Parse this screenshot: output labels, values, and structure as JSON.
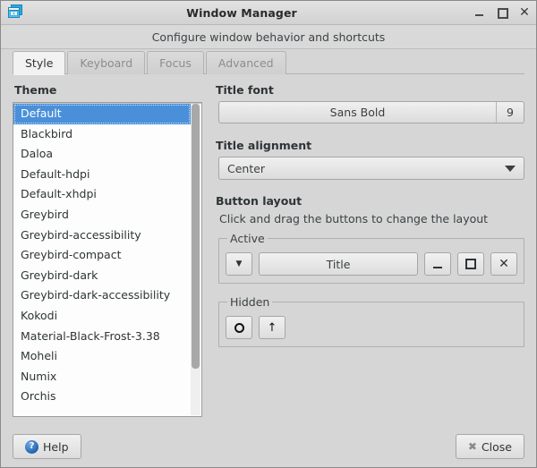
{
  "window": {
    "title": "Window Manager",
    "subtitle": "Configure window behavior and shortcuts",
    "icon": "window-stack-icon",
    "controls": {
      "minimize": "–",
      "maximize": "□",
      "close": "✕"
    }
  },
  "tabs": [
    {
      "label": "Style",
      "active": true
    },
    {
      "label": "Keyboard",
      "active": false
    },
    {
      "label": "Focus",
      "active": false
    },
    {
      "label": "Advanced",
      "active": false
    }
  ],
  "theme": {
    "label": "Theme",
    "selected": "Default",
    "items": [
      "Default",
      "Blackbird",
      "Daloa",
      "Default-hdpi",
      "Default-xhdpi",
      "Greybird",
      "Greybird-accessibility",
      "Greybird-compact",
      "Greybird-dark",
      "Greybird-dark-accessibility",
      "Kokodi",
      "Material-Black-Frost-3.38",
      "Moheli",
      "Numix",
      "Orchis"
    ],
    "scroll_thumb_percent": 85
  },
  "title_font": {
    "label": "Title font",
    "font_name": "Sans Bold",
    "font_size": "9"
  },
  "title_alignment": {
    "label": "Title alignment",
    "value": "Center"
  },
  "button_layout": {
    "label": "Button layout",
    "hint": "Click and drag the buttons to change the layout",
    "active": {
      "legend": "Active",
      "buttons": [
        {
          "name": "menu-button",
          "glyph": "▼"
        },
        {
          "name": "title-placeholder",
          "glyph": "Title"
        },
        {
          "name": "minimize-button",
          "glyph": "–"
        },
        {
          "name": "maximize-button",
          "glyph": "□"
        },
        {
          "name": "close-button",
          "glyph": "✕"
        }
      ]
    },
    "hidden": {
      "legend": "Hidden",
      "buttons": [
        {
          "name": "shade-button",
          "glyph": "○"
        },
        {
          "name": "stick-button",
          "glyph": "↑"
        }
      ]
    }
  },
  "footer": {
    "help_label": "Help",
    "help_icon_char": "?",
    "close_label": "Close",
    "close_icon_char": "✖"
  },
  "colors": {
    "background": "#d6d6d6",
    "selection": "#4a90d9",
    "text": "#2e3436",
    "inactive_tab_text": "#8d8d8d"
  }
}
